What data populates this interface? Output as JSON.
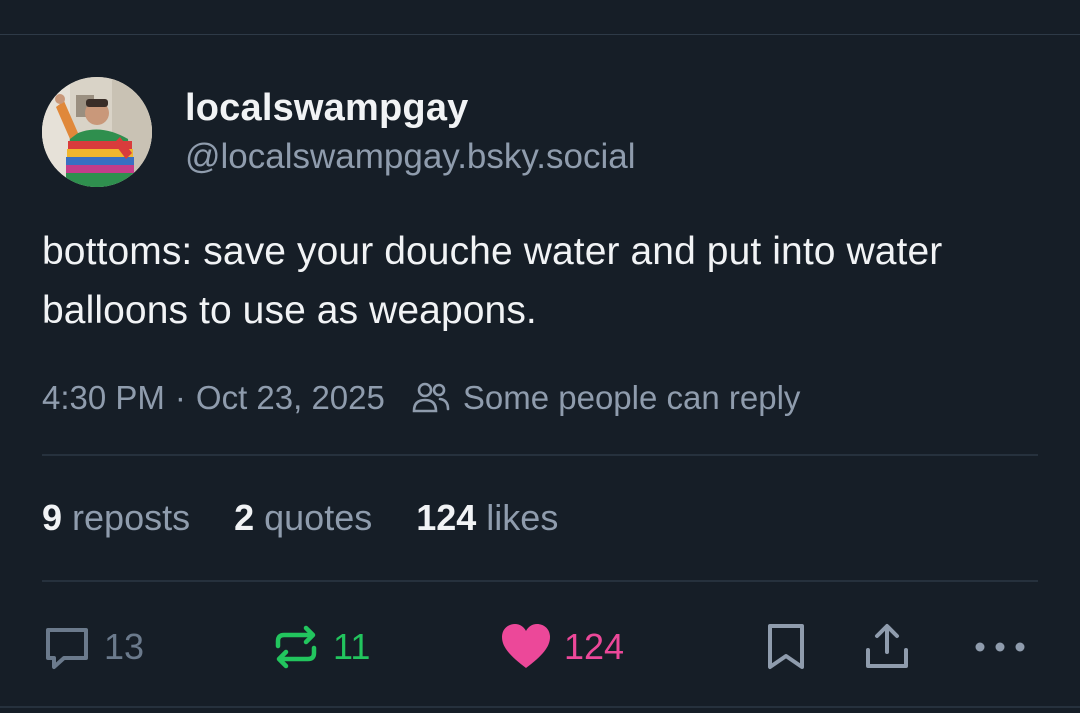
{
  "author": {
    "display_name": "localswampgay",
    "handle": "@localswampgay.bsky.social",
    "avatar_icon": "avatar-photo"
  },
  "post": {
    "text": "bottoms: save your douche water and put into water balloons to use as weapons.",
    "time": "4:30 PM",
    "separator": "·",
    "date": "Oct 23, 2025",
    "reply_restriction": "Some people can reply"
  },
  "stats": {
    "reposts_count": "9",
    "reposts_label": "reposts",
    "quotes_count": "2",
    "quotes_label": "quotes",
    "likes_count": "124",
    "likes_label": "likes"
  },
  "actions": {
    "reply_count": "13",
    "repost_count": "11",
    "like_count": "124",
    "icons": {
      "reply": "speech-bubble-icon",
      "repost": "repost-arrows-icon",
      "like": "heart-icon",
      "bookmark": "bookmark-icon",
      "share": "share-icon",
      "more": "ellipsis-icon"
    }
  },
  "colors": {
    "background": "#161e27",
    "text_primary": "#f1f3f5",
    "text_secondary": "#8f9cad",
    "repost_active": "#22c55e",
    "like_active": "#ec4899"
  }
}
